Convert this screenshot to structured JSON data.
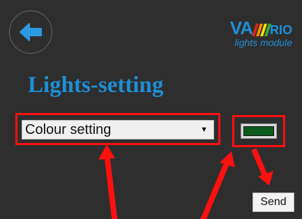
{
  "header": {
    "back_icon": "arrow-left-icon",
    "logo": {
      "brand_main": "VA",
      "brand_end": "RIO",
      "tagline": "lights module"
    }
  },
  "main": {
    "title": "Lights-setting",
    "mode_select": {
      "selected": "Colour setting",
      "icon": "caret-down-icon"
    },
    "colour_swatch": {
      "color": "#0d5a1d"
    },
    "send_label": "Send"
  },
  "colors": {
    "background": "#2e2e2e",
    "accent": "#1e8fd6",
    "annotation": "#ff1010",
    "logo_stripes": [
      "#e2231a",
      "#f39200",
      "#ffdd00",
      "#3aaa35"
    ]
  }
}
